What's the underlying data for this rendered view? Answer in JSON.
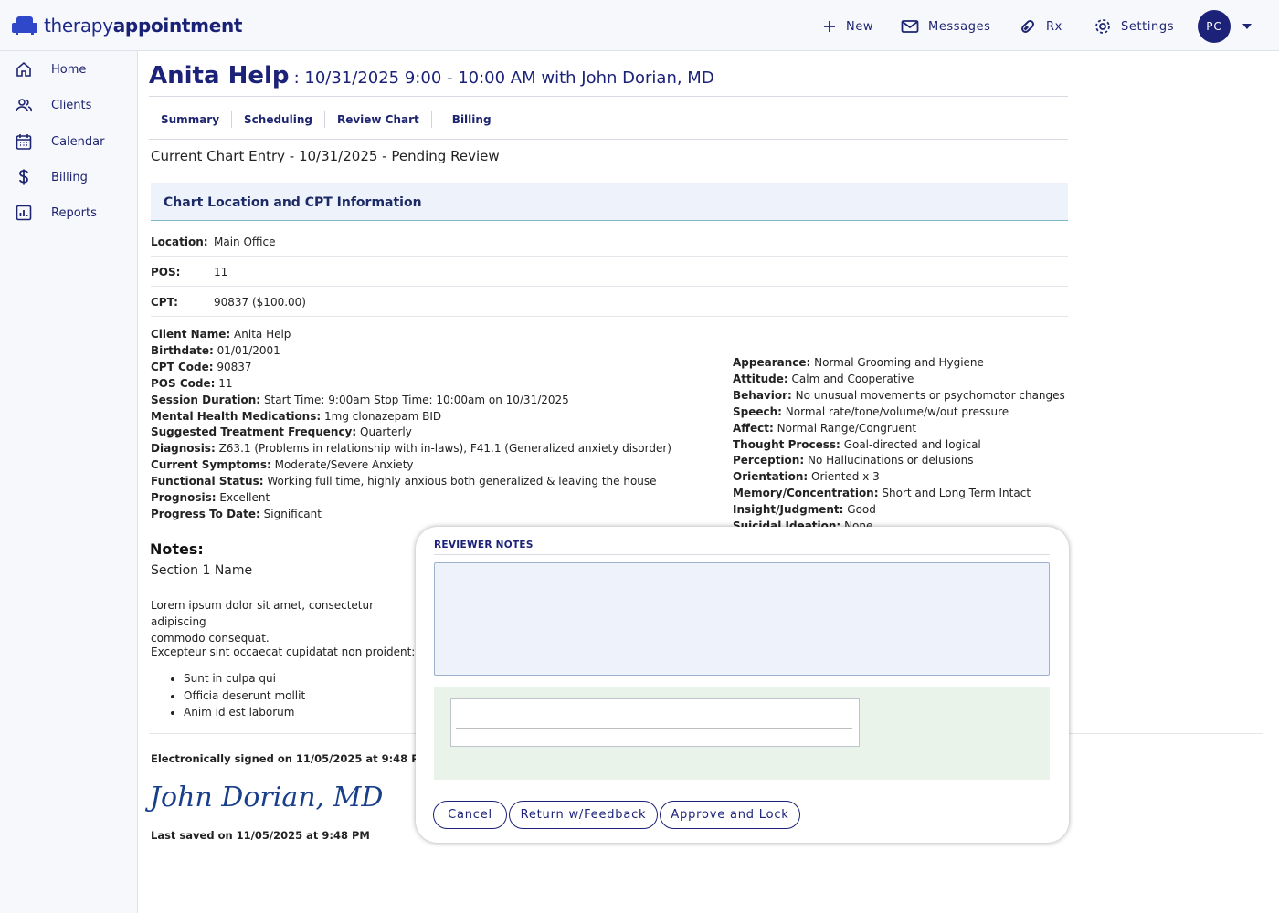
{
  "app": {
    "logo_light": "therapy",
    "logo_bold": "appointment"
  },
  "topnav": {
    "new_label": "New",
    "messages_label": "Messages",
    "rx_label": "Rx",
    "settings_label": "Settings",
    "avatar_initials": "PC"
  },
  "sidebar": {
    "items": [
      {
        "label": "Home",
        "icon": "home-icon"
      },
      {
        "label": "Clients",
        "icon": "users-icon"
      },
      {
        "label": "Calendar",
        "icon": "calendar-icon"
      },
      {
        "label": "Billing",
        "icon": "dollar-icon"
      },
      {
        "label": "Reports",
        "icon": "chart-icon"
      }
    ]
  },
  "header": {
    "client_name": "Anita Help",
    "appointment": ": 10/31/2025 9:00 - 10:00 AM with John Dorian, MD"
  },
  "tabs": [
    "Summary",
    "Scheduling",
    "Review Chart",
    "Billing"
  ],
  "entry_title": "Current Chart Entry - 10/31/2025 - Pending Review",
  "section_title": "Chart Location and CPT Information",
  "location_info": [
    {
      "key": "Location:",
      "value": "Main Office"
    },
    {
      "key": "POS:",
      "value": "11"
    },
    {
      "key": "CPT:",
      "value": "90837 ($100.00)"
    }
  ],
  "client_details": [
    {
      "key": "Client Name:",
      "value": "Anita Help"
    },
    {
      "key": "Birthdate:",
      "value": "01/01/2001"
    },
    {
      "key": "CPT Code:",
      "value": "90837"
    },
    {
      "key": "POS Code:",
      "value": "11"
    },
    {
      "key": "Session Duration:",
      "value": "Start Time: 9:00am Stop Time: 10:00am on 10/31/2025"
    },
    {
      "key": "Mental Health Medications:",
      "value": "1mg clonazepam BID"
    },
    {
      "key": "Suggested Treatment Frequency:",
      "value": "Quarterly"
    },
    {
      "key": "Diagnosis:",
      "value": "Z63.1 (Problems in relationship with in-laws), F41.1 (Generalized anxiety disorder)"
    },
    {
      "key": "Current Symptoms:",
      "value": "Moderate/Severe Anxiety"
    },
    {
      "key": "Functional Status:",
      "value": "Working full time, highly anxious both generalized & leaving the house"
    },
    {
      "key": "Prognosis:",
      "value": "Excellent"
    },
    {
      "key": "Progress To Date:",
      "value": "Significant"
    }
  ],
  "mental_status": [
    {
      "key": "Appearance:",
      "value": "Normal Grooming and Hygiene"
    },
    {
      "key": "Attitude:",
      "value": "Calm and Cooperative"
    },
    {
      "key": "Behavior:",
      "value": "No unusual movements or psychomotor changes"
    },
    {
      "key": "Speech:",
      "value": "Normal rate/tone/volume/w/out pressure"
    },
    {
      "key": "Affect:",
      "value": "Normal Range/Congruent"
    },
    {
      "key": "Thought Process:",
      "value": "Goal-directed and logical"
    },
    {
      "key": "Perception:",
      "value": "No Hallucinations or delusions"
    },
    {
      "key": "Orientation:",
      "value": "Oriented x 3"
    },
    {
      "key": "Memory/Concentration:",
      "value": "Short and Long Term Intact"
    },
    {
      "key": "Insight/Judgment:",
      "value": "Good"
    },
    {
      "key": "Suicidal Ideation:",
      "value": "None"
    }
  ],
  "notes": {
    "heading": "Notes:",
    "section_name": "Section 1 Name",
    "paragraph1_line1": "Lorem ipsum dolor sit amet, consectetur adipiscing",
    "paragraph1_line2": "commodo consequat.",
    "paragraph2": "Excepteur sint occaecat cupidatat non proident:",
    "bullets": [
      "Sunt in culpa qui",
      "Officia deserunt mollit",
      "Anim id est laborum"
    ]
  },
  "signature": {
    "signed_text": "Electronically signed on 11/05/2025 at 9:48 PM",
    "name": "John Dorian, MD",
    "saved_text": "Last saved on 11/05/2025 at 9:48 PM"
  },
  "modal": {
    "label": "REVIEWER NOTES",
    "notes_value": "",
    "cancel_label": "Cancel",
    "return_label": "Return w/Feedback",
    "approve_label": "Approve and Lock"
  }
}
